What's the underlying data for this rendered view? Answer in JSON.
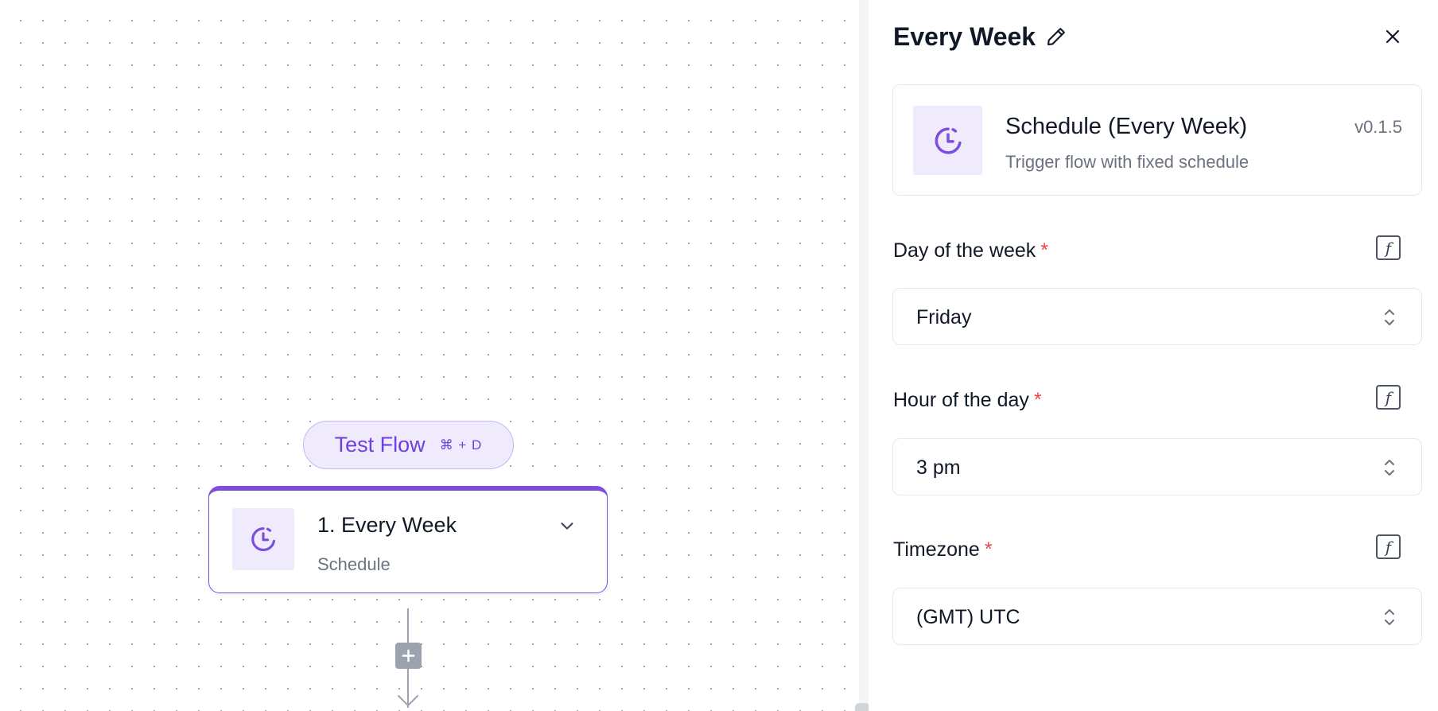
{
  "canvas": {
    "test_flow": {
      "label": "Test Flow",
      "shortcut": "⌘ + D"
    },
    "step": {
      "title": "1. Every Week",
      "subtitle": "Schedule",
      "icon": "clock-icon"
    },
    "add_step_icon": "plus-icon"
  },
  "panel": {
    "title": "Every Week",
    "edit_icon": "pencil-icon",
    "close_icon": "close-icon",
    "piece": {
      "name": "Schedule (Every Week)",
      "description": "Trigger flow with fixed schedule",
      "version": "v0.1.5",
      "icon": "clock-icon"
    },
    "fields": [
      {
        "label": "Day of the week",
        "required_marker": "*",
        "value": "Friday"
      },
      {
        "label": "Hour of the day",
        "required_marker": "*",
        "value": "3 pm"
      },
      {
        "label": "Timezone",
        "required_marker": "*",
        "value": "(GMT) UTC"
      }
    ],
    "fx_glyph": "f"
  },
  "colors": {
    "accent": "#7c4ddf",
    "accent_light": "#efebfd",
    "required": "#ef4444",
    "muted_text": "#6b7280",
    "border": "#e5e7eb"
  }
}
